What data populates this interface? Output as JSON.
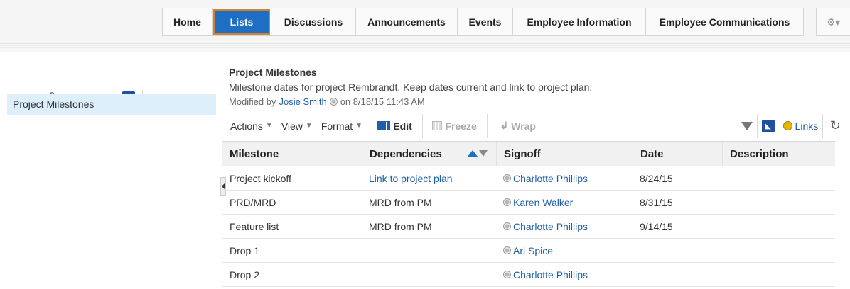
{
  "nav": {
    "tabs": [
      {
        "label": "Home"
      },
      {
        "label": "Lists"
      },
      {
        "label": "Discussions"
      },
      {
        "label": "Announcements"
      },
      {
        "label": "Events"
      },
      {
        "label": "Employee Information"
      },
      {
        "label": "Employee Communications"
      }
    ],
    "active_tab": "Lists",
    "settings_icon": "gear-icon"
  },
  "sidebar": {
    "toolbar_icons": [
      "add-icon",
      "copy-icon",
      "wrench-icon",
      "delete-icon",
      "rss-icon",
      "refresh-icon",
      "help-icon"
    ],
    "items": [
      {
        "label": "Project Milestones",
        "selected": true
      }
    ]
  },
  "list": {
    "title": "Project Milestones",
    "description": "Milestone dates for project Rembrandt. Keep dates current and link to project plan.",
    "modified_prefix": "Modified by",
    "modified_by": "Josie Smith",
    "modified_on": "on 8/18/15 11:43 AM"
  },
  "toolbar": {
    "actions": "Actions",
    "view": "View",
    "format": "Format",
    "edit": "Edit",
    "freeze": "Freeze",
    "wrap": "Wrap",
    "links": "Links"
  },
  "table": {
    "columns": [
      "Milestone",
      "Dependencies",
      "Signoff",
      "Date",
      "Description"
    ],
    "sorted_column": "Dependencies",
    "rows": [
      {
        "milestone": "Project kickoff",
        "dependencies": "Link to project plan",
        "dependencies_is_link": true,
        "signoff": "Charlotte Phillips",
        "date": "8/24/15",
        "description": ""
      },
      {
        "milestone": "PRD/MRD",
        "dependencies": "MRD from PM",
        "dependencies_is_link": false,
        "signoff": "Karen Walker",
        "date": "8/31/15",
        "description": ""
      },
      {
        "milestone": "Feature list",
        "dependencies": "MRD from PM",
        "dependencies_is_link": false,
        "signoff": "Charlotte Phillips",
        "date": "9/14/15",
        "description": ""
      },
      {
        "milestone": "Drop 1",
        "dependencies": "",
        "dependencies_is_link": false,
        "signoff": "Ari Spice",
        "date": "",
        "description": ""
      },
      {
        "milestone": "Drop 2",
        "dependencies": "",
        "dependencies_is_link": false,
        "signoff": "Charlotte Phillips",
        "date": "",
        "description": ""
      }
    ]
  },
  "colors": {
    "accent": "#1e6fc4",
    "active_outline": "#d4822c",
    "link": "#1f5fa8",
    "selected_item_bg": "#dceffb"
  }
}
